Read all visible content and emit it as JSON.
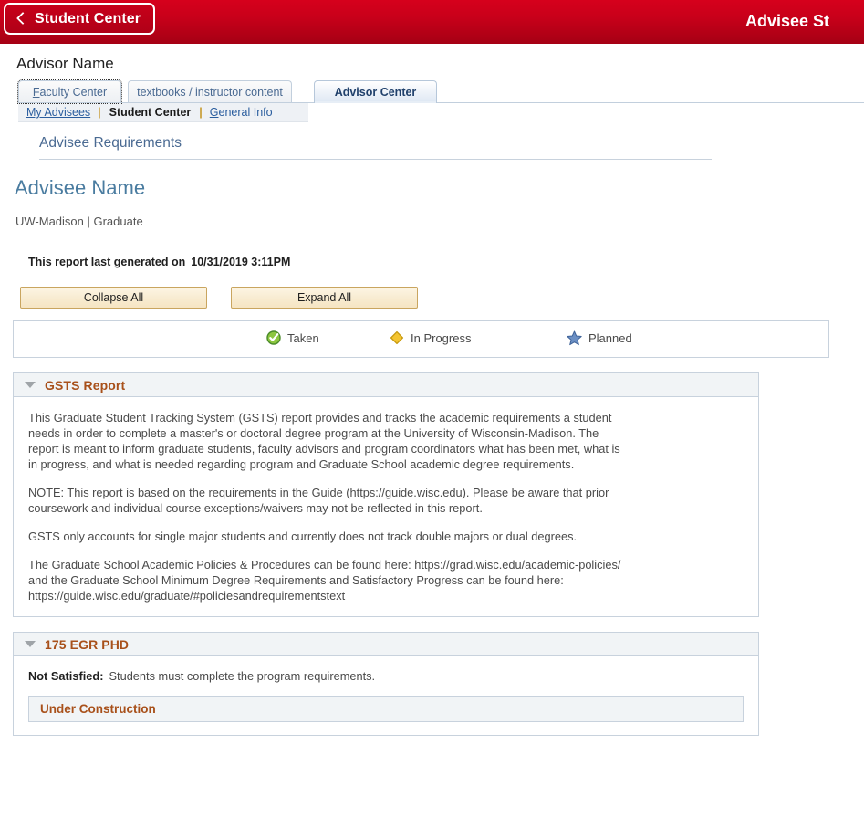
{
  "header": {
    "back_label": "Student Center",
    "back_icon": "chevron-left-icon",
    "title": "Advisee St",
    "brand_color": "#c9001a"
  },
  "advisor": {
    "name": "Advisor Name"
  },
  "tabs": [
    {
      "label": "Faculty Center",
      "accesskey_letter": "F",
      "active": false
    },
    {
      "label": "textbooks / instructor content",
      "active": false
    },
    {
      "label": "Advisor Center",
      "active": true
    }
  ],
  "subnav": {
    "items": [
      {
        "label": "My Advisees",
        "current": false
      },
      {
        "label": "Student Center",
        "current": true
      },
      {
        "label": "General Info",
        "current": false
      }
    ],
    "separator": "|"
  },
  "page": {
    "requirements_heading": "Advisee Requirements",
    "advisee_name": "Advisee Name",
    "institution_career": "UW-Madison | Graduate",
    "report_generated_label": "This report last generated on",
    "report_generated_value": "10/31/2019  3:11PM"
  },
  "buttons": {
    "collapse_all": "Collapse All",
    "expand_all": "Expand All"
  },
  "legend": [
    {
      "label": "Taken",
      "icon": "green-check-circle-icon",
      "color": "#5f9e3f"
    },
    {
      "label": "In Progress",
      "icon": "gold-diamond-icon",
      "color": "#e8b923"
    },
    {
      "label": "Planned",
      "icon": "blue-star-icon",
      "color": "#5b7fb0"
    }
  ],
  "sections": [
    {
      "title": "GSTS Report",
      "collapse_icon": "triangle-down-icon",
      "paragraphs": [
        "This Graduate Student Tracking System (GSTS) report provides and tracks the academic requirements a student needs in order to complete a master's or doctoral degree program at the University of Wisconsin-Madison. The report is meant to inform graduate students, faculty advisors and program coordinators what has been met, what is in progress, and what is needed regarding program and Graduate School academic degree requirements.",
        "NOTE: This report is based on the requirements in the Guide (https://guide.wisc.edu). Please be aware that prior coursework and individual course exceptions/waivers may not be reflected in this report.",
        "GSTS only accounts for single major students and currently does not track double majors or dual degrees.",
        "The Graduate School Academic Policies & Procedures can be found here: https://grad.wisc.edu/academic-policies/ and the Graduate School Minimum Degree Requirements and Satisfactory Progress can be found here: https://guide.wisc.edu/graduate/#policiesandrequirementstext"
      ]
    },
    {
      "title": "175 EGR PHD",
      "collapse_icon": "triangle-down-icon",
      "status_label": "Not Satisfied:",
      "status_text": "Students must complete the program requirements.",
      "subsection_title": "Under Construction"
    }
  ]
}
